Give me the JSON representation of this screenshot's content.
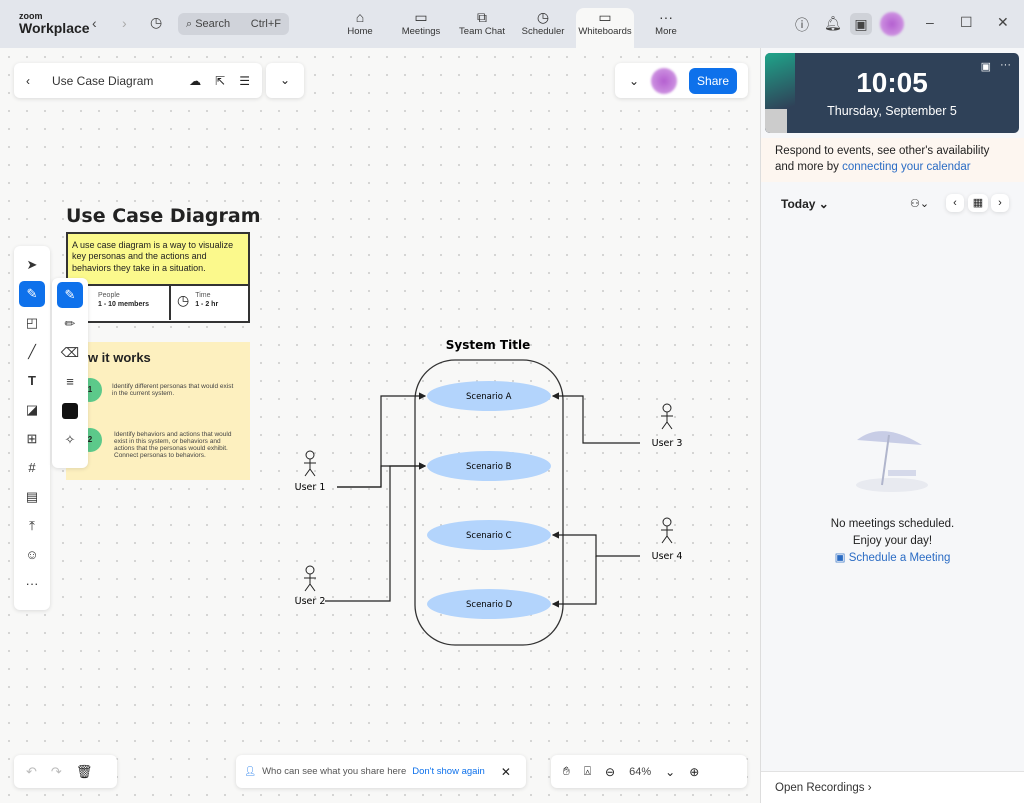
{
  "app": {
    "logo_small": "zoom",
    "logo_big": "Workplace",
    "search_placeholder": "Search",
    "search_shortcut": "Ctrl+F"
  },
  "nav": [
    {
      "label": "Home",
      "icon": "home-icon"
    },
    {
      "label": "Meetings",
      "icon": "video-icon"
    },
    {
      "label": "Team Chat",
      "icon": "chat-icon"
    },
    {
      "label": "Scheduler",
      "icon": "clock-icon"
    },
    {
      "label": "Whiteboards",
      "icon": "whiteboard-icon",
      "active": true
    },
    {
      "label": "More",
      "icon": "more-icon"
    }
  ],
  "board": {
    "title": "Use Case Diagram",
    "share_label": "Share",
    "zoom": "64%"
  },
  "template": {
    "title": "Use Case Diagram",
    "description": "A use case diagram is a way to visualize key personas and the actions and behaviors they take in a situation.",
    "people_label": "People",
    "people_value": "1 - 10 members",
    "time_label": "Time",
    "time_value": "1 - 2 hr",
    "how_title": "ow it works",
    "step1_num": "1",
    "step1": "Identify different personas that would exist in the current system.",
    "step2_num": "2",
    "step2": "Identify behaviors and actions that would exist in this system, or behaviors and actions that the personas would exhibit. Connect personas to behaviors."
  },
  "diagram": {
    "system_title": "System Title",
    "scenarios": [
      "Scenario A",
      "Scenario B",
      "Scenario C",
      "Scenario D"
    ],
    "users": [
      "User 1",
      "User 2",
      "User 3",
      "User 4"
    ],
    "scenario_color": "#b3d4fc"
  },
  "notice": {
    "text": "Who can see what you share here",
    "link": "Don't show again"
  },
  "calendar": {
    "time": "10:05",
    "date": "Thursday, September 5",
    "prompt": "Respond to events, see other's availability and more by ",
    "prompt_link": "connecting your calendar",
    "today": "Today",
    "empty1": "No meetings scheduled.",
    "empty2": "Enjoy your day!",
    "schedule": "Schedule a Meeting",
    "recordings": "Open Recordings"
  }
}
